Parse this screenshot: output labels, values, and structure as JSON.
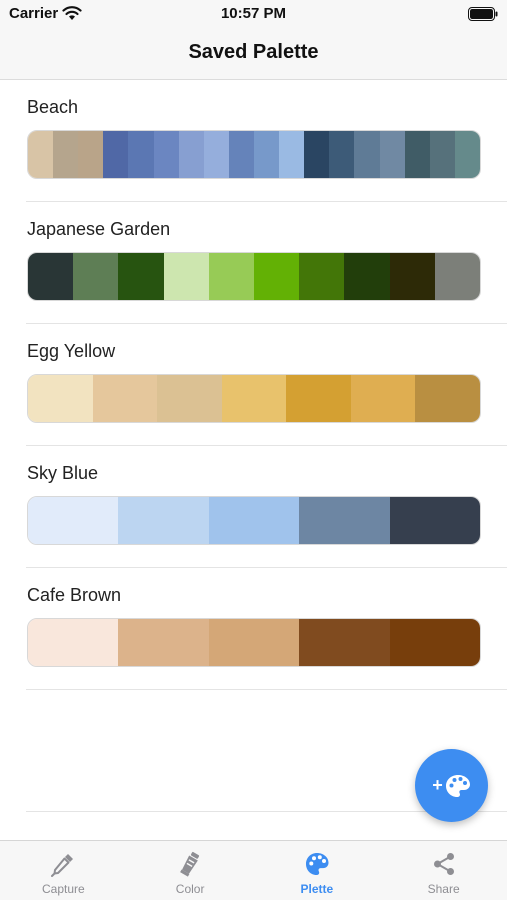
{
  "status": {
    "carrier": "Carrier",
    "time": "10:57 PM"
  },
  "nav": {
    "title": "Saved Palette"
  },
  "palettes": [
    {
      "name": "Beach",
      "colors": [
        "#d8c4a6",
        "#b5a58d",
        "#b9a489",
        "#5068a6",
        "#5b77b3",
        "#6b86c1",
        "#879fd1",
        "#95aedc",
        "#6583ba",
        "#7799ca",
        "#9abae3",
        "#2a4562",
        "#3d5b78",
        "#5f7b96",
        "#7089a3",
        "#405c66",
        "#56717b",
        "#658a8b"
      ]
    },
    {
      "name": "Japanese Garden",
      "colors": [
        "#293636",
        "#5e7e55",
        "#275410",
        "#cde6af",
        "#97cb56",
        "#63b105",
        "#437608",
        "#223e0b",
        "#2d2a07",
        "#7c7f79"
      ]
    },
    {
      "name": "Egg Yellow",
      "colors": [
        "#f2e3c0",
        "#e5c79c",
        "#dbc193",
        "#e8c26c",
        "#d4a032",
        "#dfae51",
        "#b98f41"
      ]
    },
    {
      "name": "Sky Blue",
      "colors": [
        "#e1ebfa",
        "#bcd5f1",
        "#a0c3ec",
        "#6d86a3",
        "#363f4e"
      ]
    },
    {
      "name": "Cafe Brown",
      "colors": [
        "#f9e7dc",
        "#dcb38b",
        "#d4a777",
        "#804b1f",
        "#773e0c"
      ]
    }
  ],
  "fab": {
    "plus": "+",
    "icon": "palette-icon"
  },
  "tabs": [
    {
      "label": "Capture",
      "icon": "eyedropper-icon",
      "active": false
    },
    {
      "label": "Color",
      "icon": "paint-tube-icon",
      "active": false
    },
    {
      "label": "Plette",
      "icon": "palette-icon",
      "active": true
    },
    {
      "label": "Share",
      "icon": "share-icon",
      "active": false
    }
  ],
  "colors": {
    "accent": "#3d8df1",
    "inactive": "#8e8e93"
  }
}
